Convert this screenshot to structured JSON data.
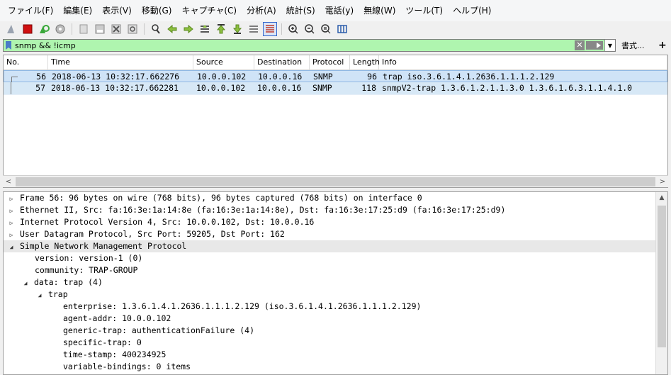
{
  "menu": [
    "ファイル(F)",
    "編集(E)",
    "表示(V)",
    "移動(G)",
    "キャプチャ(C)",
    "分析(A)",
    "統計(S)",
    "電話(y)",
    "無線(W)",
    "ツール(T)",
    "ヘルプ(H)"
  ],
  "filter": {
    "value": "snmp && !icmp",
    "expression_label": "書式...",
    "add_label": "+"
  },
  "columns": {
    "no": "No.",
    "time": "Time",
    "source": "Source",
    "destination": "Destination",
    "protocol": "Protocol",
    "length": "Length",
    "info": "Info"
  },
  "packets": [
    {
      "no": "56",
      "time": "2018-06-13 10:32:17.662276",
      "source": "10.0.0.102",
      "destination": "10.0.0.16",
      "protocol": "SNMP",
      "length": "96",
      "info": "trap iso.3.6.1.4.1.2636.1.1.1.2.129"
    },
    {
      "no": "57",
      "time": "2018-06-13 10:32:17.662281",
      "source": "10.0.0.102",
      "destination": "10.0.0.16",
      "protocol": "SNMP",
      "length": "118",
      "info": "snmpV2-trap 1.3.6.1.2.1.1.3.0 1.3.6.1.6.3.1.1.4.1.0"
    }
  ],
  "details": [
    {
      "text": "Frame 56: 96 bytes on wire (768 bits), 96 bytes captured (768 bits) on interface 0",
      "toggle": "▷"
    },
    {
      "text": "Ethernet II, Src: fa:16:3e:1a:14:8e (fa:16:3e:1a:14:8e), Dst: fa:16:3e:17:25:d9 (fa:16:3e:17:25:d9)",
      "toggle": "▷"
    },
    {
      "text": "Internet Protocol Version 4, Src: 10.0.0.102, Dst: 10.0.0.16",
      "toggle": "▷"
    },
    {
      "text": "User Datagram Protocol, Src Port: 59205, Dst Port: 162",
      "toggle": "▷"
    },
    {
      "text": "Simple Network Management Protocol",
      "toggle": "◢"
    },
    {
      "text": "version: version-1 (0)",
      "toggle": ""
    },
    {
      "text": "community: TRAP-GROUP",
      "toggle": ""
    },
    {
      "text": "data: trap (4)",
      "toggle": "◢"
    },
    {
      "text": "trap",
      "toggle": "◢"
    },
    {
      "text": "enterprise: 1.3.6.1.4.1.2636.1.1.1.2.129 (iso.3.6.1.4.1.2636.1.1.1.2.129)",
      "toggle": ""
    },
    {
      "text": "agent-addr: 10.0.0.102",
      "toggle": ""
    },
    {
      "text": "generic-trap: authenticationFailure (4)",
      "toggle": ""
    },
    {
      "text": "specific-trap: 0",
      "toggle": ""
    },
    {
      "text": "time-stamp: 400234925",
      "toggle": ""
    },
    {
      "text": "variable-bindings: 0 items",
      "toggle": ""
    }
  ],
  "icons": [
    "shark-fin-icon",
    "stop-icon",
    "restart-icon",
    "options-icon",
    "open-icon",
    "save-icon",
    "close-file-icon",
    "reload-icon",
    "find-icon",
    "back-icon",
    "forward-icon",
    "goto-icon",
    "first-icon",
    "last-icon",
    "autoscroll-icon",
    "colorize-icon",
    "zoom-in-icon",
    "zoom-out-icon",
    "zoom-normal-icon",
    "resize-columns-icon"
  ],
  "colors": {
    "filter_valid": "#aff5af",
    "row_selected": "#cfe3f7"
  }
}
